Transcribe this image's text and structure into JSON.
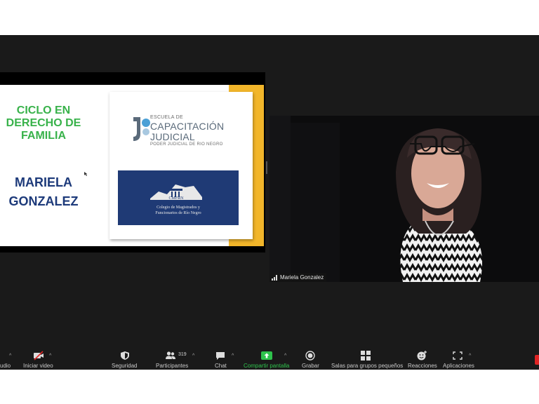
{
  "window": {
    "label": ""
  },
  "slide": {
    "title": "CICLO EN\nDERECHO DE\nFAMILIA",
    "speaker": "MARIELA\nGONZALEZ",
    "escuela": {
      "small": "ESCUELA DE",
      "line1": "CAPACITACIÓN",
      "line2": "JUDICIAL",
      "sub": "PODER JUDICIAL DE RIO NEGRO"
    },
    "colegio": {
      "abbr": "CMFRN",
      "line1": "Colegio de Magistrados y",
      "line2": "Funcionarios de Río Negro"
    },
    "accent": "#f2b62a",
    "title_color": "#38b24a",
    "name_color": "#1d3a7a"
  },
  "participant": {
    "name": "Mariela Gonzalez"
  },
  "toolbar": {
    "audio": "udio",
    "video": "Iniciar video",
    "security": "Seguridad",
    "participants": "Participantes",
    "participants_count": "319",
    "chat": "Chat",
    "share": "Compartir pantalla",
    "record": "Grabar",
    "breakout": "Salas para grupos pequeños",
    "reactions": "Reacciones",
    "apps": "Aplicaciones"
  },
  "icons": [
    "audio-icon",
    "video-off-icon",
    "shield-icon",
    "participants-icon",
    "chat-icon",
    "share-screen-icon",
    "record-icon",
    "breakout-rooms-icon",
    "reactions-icon",
    "apps-icon",
    "signal-icon"
  ],
  "colors": {
    "share_green": "#2ec24c",
    "toolbar_bg": "#1a1a1a"
  }
}
